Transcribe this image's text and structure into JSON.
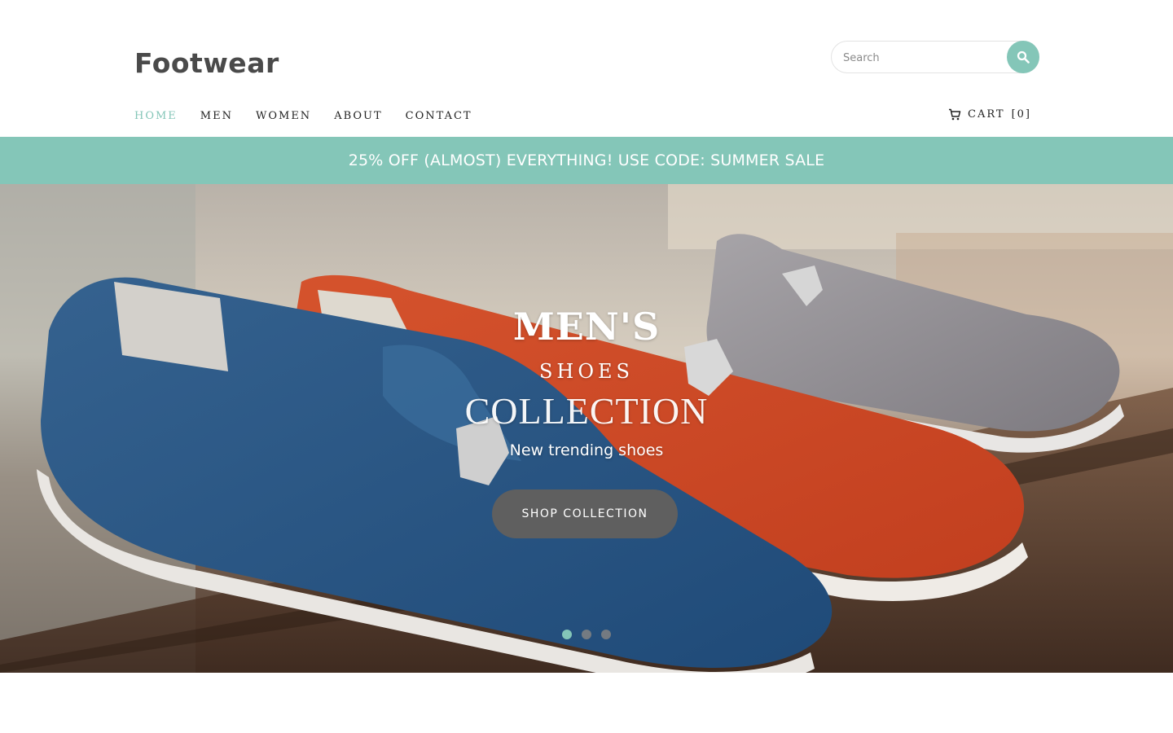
{
  "header": {
    "brand": "Footwear",
    "search": {
      "placeholder": "Search",
      "value": ""
    },
    "nav": [
      {
        "label": "HOME",
        "active": true
      },
      {
        "label": "MEN",
        "active": false
      },
      {
        "label": "WOMEN",
        "active": false
      },
      {
        "label": "ABOUT",
        "active": false
      },
      {
        "label": "CONTACT",
        "active": false
      }
    ],
    "cart": {
      "label": "CART",
      "count": "[0]"
    }
  },
  "promo": {
    "text": "25% OFF (ALMOST) EVERYTHING! USE CODE: SUMMER SALE"
  },
  "hero": {
    "title": "MEN'S",
    "subtitle1": "SHOES",
    "subtitle2": "COLLECTION",
    "tagline": "New trending shoes",
    "button_label": "SHOP COLLECTION",
    "slides": [
      {
        "active": true
      },
      {
        "active": false
      },
      {
        "active": false
      }
    ]
  },
  "icons": {
    "search": "search-icon",
    "cart": "cart-icon"
  },
  "colors": {
    "accent": "#84c6b8",
    "brand_text": "#4a4a4a",
    "nav_text": "#222222",
    "button_bg": "#5f5f5f"
  }
}
